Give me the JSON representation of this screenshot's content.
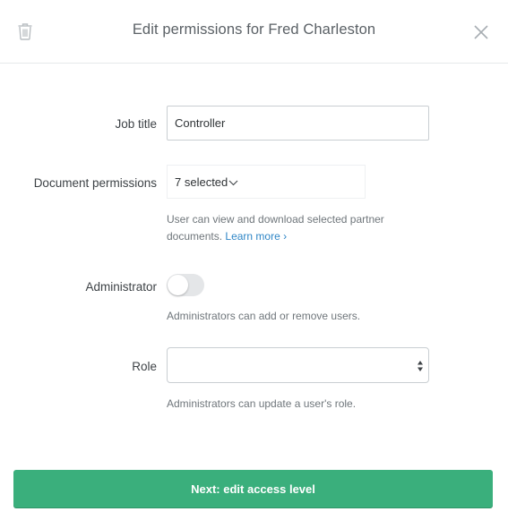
{
  "header": {
    "title": "Edit permissions for Fred Charleston",
    "delete_icon": "trash-icon",
    "close_icon": "close-icon"
  },
  "form": {
    "job_title": {
      "label": "Job title",
      "value": "Controller"
    },
    "document_permissions": {
      "label": "Document permissions",
      "selected_text": "7 selected",
      "help_text": "User can view and download selected partner documents.",
      "learn_more": "Learn more ›"
    },
    "administrator": {
      "label": "Administrator",
      "enabled": false,
      "help_text": "Administrators can add or remove users."
    },
    "role": {
      "label": "Role",
      "value": "",
      "help_text": "Administrators can update a user's role."
    }
  },
  "footer": {
    "next_label": "Next: edit access level"
  },
  "colors": {
    "primary": "#3aaf7c",
    "link": "#2f86c6"
  }
}
